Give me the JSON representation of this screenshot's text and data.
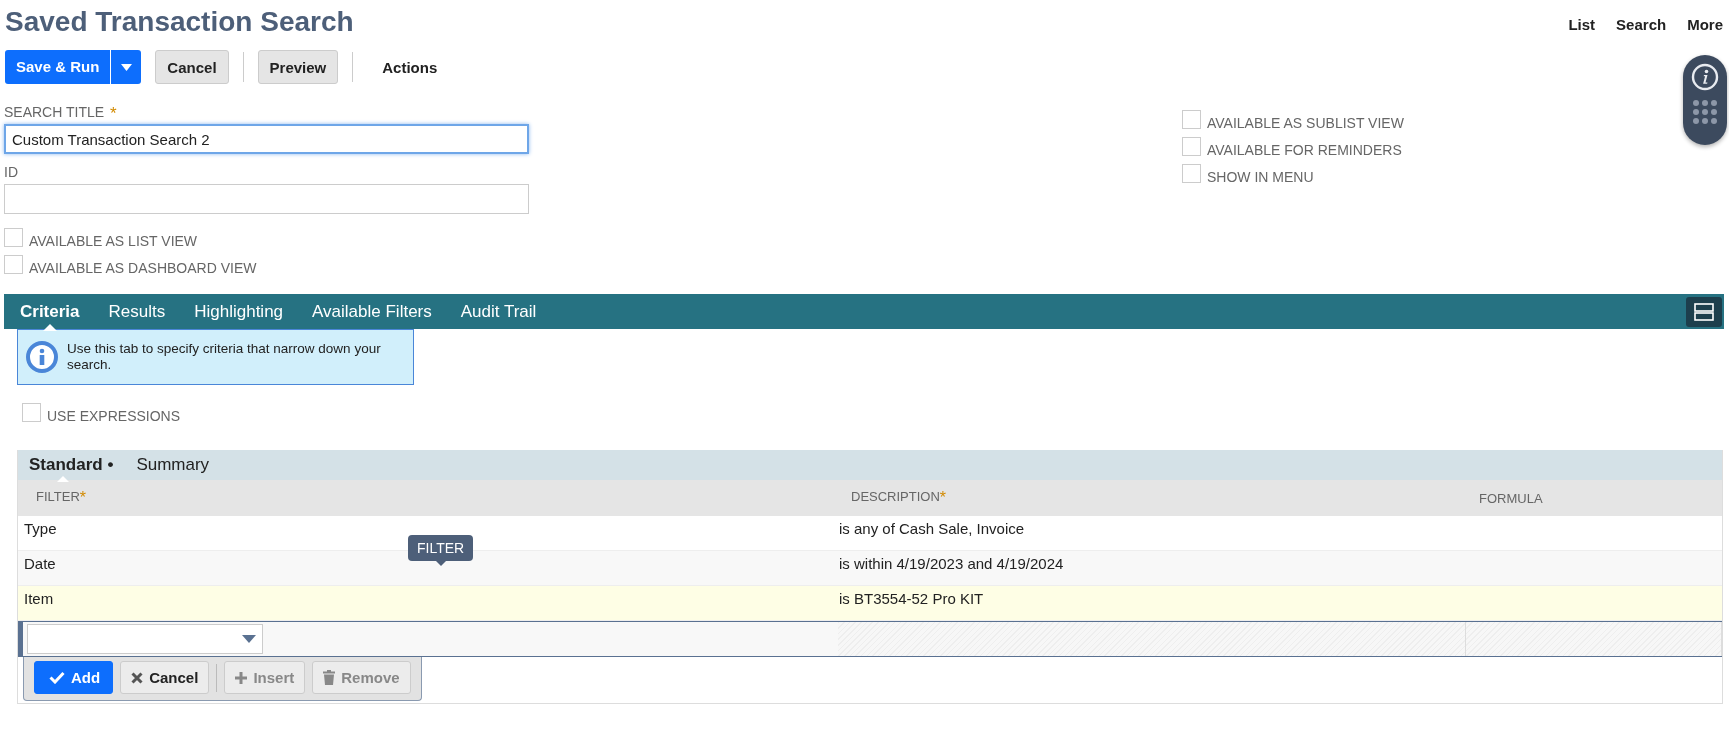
{
  "page_title": "Saved Transaction Search",
  "nav_links": [
    "List",
    "Search",
    "More"
  ],
  "toolbar": {
    "primary": "Save & Run",
    "buttons": [
      "Cancel",
      "Preview"
    ],
    "menu": "Actions"
  },
  "fields": [
    {
      "label": "SEARCH TITLE",
      "required_mark": "*",
      "value": "Custom Transaction Search 2",
      "focused": true
    },
    {
      "label": "ID",
      "focused": false
    }
  ],
  "left_checkboxes": [
    {
      "label": "AVAILABLE AS LIST VIEW",
      "checked": false
    },
    {
      "label": "AVAILABLE AS DASHBOARD VIEW",
      "checked": false
    }
  ],
  "right_checkboxes": [
    {
      "label": "AVAILABLE AS SUBLIST VIEW",
      "checked": false
    },
    {
      "label": "AVAILABLE FOR REMINDERS",
      "checked": false
    },
    {
      "label": "SHOW IN MENU",
      "checked": false
    }
  ],
  "tabs": [
    {
      "label": "Criteria",
      "selected": true
    },
    {
      "label": "Results",
      "selected": false
    },
    {
      "label": "Highlighting",
      "selected": false
    },
    {
      "label": "Available Filters",
      "selected": false
    },
    {
      "label": "Audit Trail",
      "selected": false
    }
  ],
  "info_message": "Use this tab to specify criteria that narrow down your search.",
  "use_expressions": {
    "label": "USE EXPRESSIONS",
    "checked": false
  },
  "subtabs": [
    {
      "label": "Standard",
      "marker": "•",
      "selected": true
    },
    {
      "label": "Summary",
      "selected": false
    }
  ],
  "table": {
    "columns": [
      {
        "label": "FILTER",
        "required_mark": "*"
      },
      {
        "label": "DESCRIPTION",
        "required_mark": "*"
      },
      {
        "label": "FORMULA"
      }
    ],
    "rows": [
      {
        "filter": "Type",
        "description": "is any of Cash Sale, Invoice",
        "selected": false
      },
      {
        "filter": "Date",
        "description": "is within 4/19/2023 and 4/19/2024",
        "selected": false
      },
      {
        "filter": "Item",
        "description": "is BT3554-52 Pro KIT",
        "selected": true
      }
    ],
    "tooltip": "FILTER",
    "line_buttons": [
      {
        "label": "Add",
        "kind": "add",
        "disabled": false
      },
      {
        "label": "Cancel",
        "kind": "cancel",
        "disabled": false
      },
      {
        "label": "Insert",
        "kind": "insert",
        "disabled": true
      },
      {
        "label": "Remove",
        "kind": "remove",
        "disabled": true
      }
    ]
  }
}
